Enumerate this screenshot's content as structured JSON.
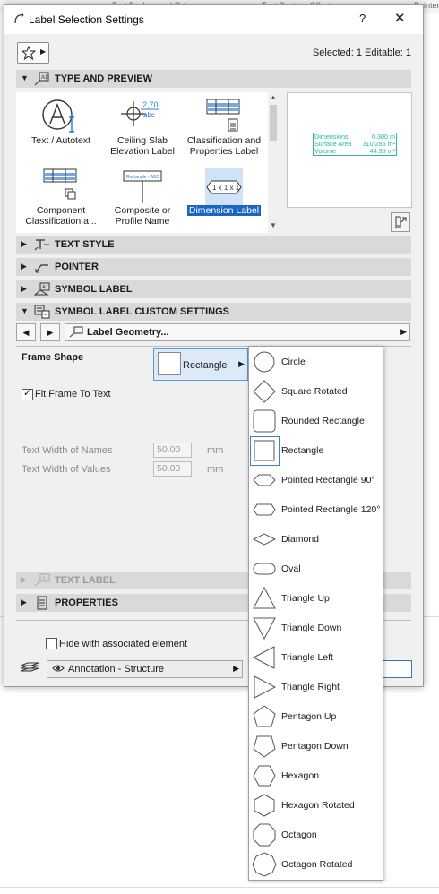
{
  "background": {
    "col1": "Text Background Color:",
    "col2": "Text Contour Offset:",
    "col3": "Pointer"
  },
  "dialog": {
    "title": "Label Selection Settings",
    "help": "?",
    "close": "✕",
    "selected_info": "Selected: 1 Editable: 1"
  },
  "sections": {
    "type_preview": "TYPE AND PREVIEW",
    "text_style": "TEXT STYLE",
    "pointer": "POINTER",
    "symbol_label": "SYMBOL LABEL",
    "symbol_custom": "SYMBOL LABEL CUSTOM SETTINGS",
    "text_label": "TEXT LABEL",
    "properties": "PROPERTIES"
  },
  "label_types": [
    {
      "label": "Text / Autotext",
      "icon": "text-autotext-icon"
    },
    {
      "label": "Ceiling Slab Elevation Label",
      "icon": "ceiling-slab-icon"
    },
    {
      "label": "Classification and Properties Label",
      "icon": "classification-icon"
    },
    {
      "label": "Component Classification a...",
      "icon": "component-classification-icon"
    },
    {
      "label": "Composite or Profile Name",
      "icon": "composite-profile-icon"
    },
    {
      "label": "Dimension Label",
      "icon": "dimension-label-icon"
    }
  ],
  "glyph_text": {
    "ceiling_value": "2,70",
    "ceiling_unit": "abc",
    "composite_sign": "Rectangle - ABC",
    "dimension_text": "1 x 1 x 1"
  },
  "preview": {
    "rows": [
      {
        "name": "Dimensions",
        "value": "0.300 m"
      },
      {
        "name": "Surface Area",
        "value": "310.285 m²"
      },
      {
        "name": "Volume",
        "value": "44.35 m³"
      }
    ]
  },
  "custom_settings": {
    "page_name": "Label Geometry...",
    "frame_shape_label": "Frame Shape",
    "frame_shape_value": "Rectangle",
    "fit_frame_label": "Fit Frame To Text",
    "fit_frame_checked": true,
    "text_width_names_label": "Text Width of Names",
    "text_width_names_value": "50.00",
    "text_width_values_label": "Text Width of Values",
    "text_width_values_value": "50.00",
    "unit": "mm"
  },
  "footer": {
    "hide_label": "Hide with associated element",
    "hide_checked": false,
    "layer": "Annotation - Structure"
  },
  "shape_options": [
    "Circle",
    "Square Rotated",
    "Rounded Rectangle",
    "Rectangle",
    "Pointed Rectangle 90°",
    "Pointed Rectangle 120°",
    "Diamond",
    "Oval",
    "Triangle Up",
    "Triangle Down",
    "Triangle Left",
    "Triangle Right",
    "Pentagon Up",
    "Pentagon Down",
    "Hexagon",
    "Hexagon Rotated",
    "Octagon",
    "Octagon Rotated"
  ],
  "selected_shape": "Rectangle",
  "colors": {
    "selection_blue": "#1a64c8",
    "preview_green": "#1dbb95",
    "section_gray": "#d9d9d9"
  }
}
